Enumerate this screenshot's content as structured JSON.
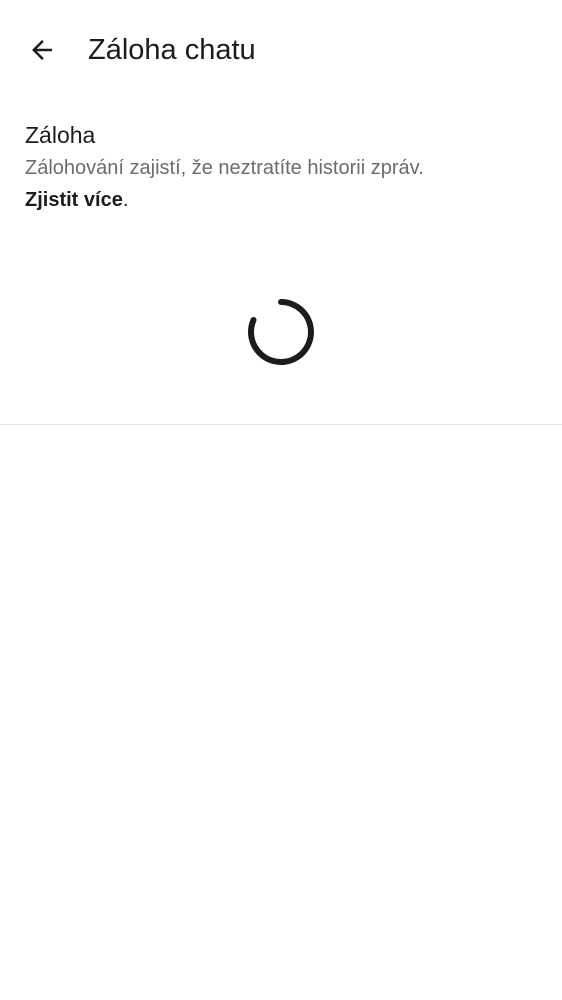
{
  "header": {
    "back_icon": "arrow-left-icon",
    "title": "Záloha chatu"
  },
  "backup_section": {
    "title": "Záloha",
    "description": "Zálohování zajistí, že neztratíte historii zpráv.",
    "learn_more_label": "Zjistit více",
    "learn_more_suffix": "."
  },
  "loading": {
    "icon": "loading-spinner-icon"
  },
  "colors": {
    "background": "#ffffff",
    "primary_text": "#1c1b1f",
    "secondary_text": "#6b6b70",
    "divider": "#e6e6e8"
  }
}
